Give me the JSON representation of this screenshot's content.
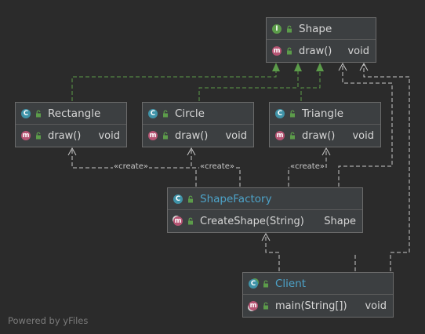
{
  "classes": {
    "shape": {
      "kind": "I",
      "name": "Shape",
      "methods": [
        {
          "kind": "m",
          "name": "draw()",
          "ret": "void"
        }
      ]
    },
    "rectangle": {
      "kind": "C",
      "name": "Rectangle",
      "methods": [
        {
          "kind": "m",
          "name": "draw()",
          "ret": "void"
        }
      ]
    },
    "circle": {
      "kind": "C",
      "name": "Circle",
      "methods": [
        {
          "kind": "m",
          "name": "draw()",
          "ret": "void"
        }
      ]
    },
    "triangle": {
      "kind": "C",
      "name": "Triangle",
      "methods": [
        {
          "kind": "m",
          "name": "draw()",
          "ret": "void"
        }
      ]
    },
    "factory": {
      "kind": "C",
      "name": "ShapeFactory",
      "methods": [
        {
          "kind": "m",
          "name": "CreateShape(String)",
          "ret": "Shape"
        }
      ]
    },
    "client": {
      "kind": "C",
      "name": "Client",
      "methods": [
        {
          "kind": "m",
          "name": "main(String[])",
          "ret": "void"
        }
      ]
    }
  },
  "edge_labels": {
    "create": "«create»"
  },
  "footer": "Powered by yFiles",
  "colors": {
    "background": "#2b2b2b",
    "node_fill": "#3c3f41",
    "node_border": "#6b6b6b",
    "implements_edge": "#5c9c4a",
    "dependency_edge": "#c8c8c8",
    "class_badge": "#3f93a8",
    "interface_badge": "#5c9c4a",
    "method_badge": "#b65473",
    "link_text": "#4da3c9"
  }
}
